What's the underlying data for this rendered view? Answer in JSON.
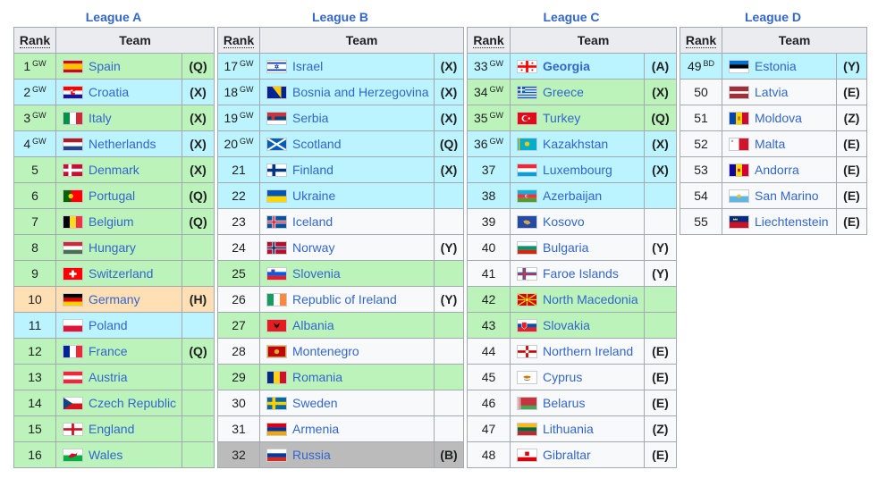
{
  "columns": {
    "rank": "Rank",
    "team": "Team"
  },
  "leagues": [
    {
      "title": "League A",
      "rows": [
        {
          "rank": "1",
          "sup": "GW",
          "team": "Spain",
          "q": "(Q)",
          "color": "green",
          "flag": "es"
        },
        {
          "rank": "2",
          "sup": "GW",
          "team": "Croatia",
          "q": "(X)",
          "color": "blue",
          "flag": "hr"
        },
        {
          "rank": "3",
          "sup": "GW",
          "team": "Italy",
          "q": "(X)",
          "color": "green",
          "flag": "it"
        },
        {
          "rank": "4",
          "sup": "GW",
          "team": "Netherlands",
          "q": "(X)",
          "color": "blue",
          "flag": "nl"
        },
        {
          "rank": "5",
          "sup": "",
          "team": "Denmark",
          "q": "(X)",
          "color": "green",
          "flag": "dk"
        },
        {
          "rank": "6",
          "sup": "",
          "team": "Portugal",
          "q": "(Q)",
          "color": "green",
          "flag": "pt"
        },
        {
          "rank": "7",
          "sup": "",
          "team": "Belgium",
          "q": "(Q)",
          "color": "green",
          "flag": "be"
        },
        {
          "rank": "8",
          "sup": "",
          "team": "Hungary",
          "q": "",
          "color": "green",
          "flag": "hu"
        },
        {
          "rank": "9",
          "sup": "",
          "team": "Switzerland",
          "q": "",
          "color": "green",
          "flag": "ch"
        },
        {
          "rank": "10",
          "sup": "",
          "team": "Germany",
          "q": "(H)",
          "color": "orange",
          "flag": "de"
        },
        {
          "rank": "11",
          "sup": "",
          "team": "Poland",
          "q": "",
          "color": "blue",
          "flag": "pl"
        },
        {
          "rank": "12",
          "sup": "",
          "team": "France",
          "q": "(Q)",
          "color": "green",
          "flag": "fr"
        },
        {
          "rank": "13",
          "sup": "",
          "team": "Austria",
          "q": "",
          "color": "green",
          "flag": "at"
        },
        {
          "rank": "14",
          "sup": "",
          "team": "Czech Republic",
          "q": "",
          "color": "green",
          "flag": "cz"
        },
        {
          "rank": "15",
          "sup": "",
          "team": "England",
          "q": "",
          "color": "green",
          "flag": "en"
        },
        {
          "rank": "16",
          "sup": "",
          "team": "Wales",
          "q": "",
          "color": "green",
          "flag": "wa"
        }
      ]
    },
    {
      "title": "League B",
      "rows": [
        {
          "rank": "17",
          "sup": "GW",
          "team": "Israel",
          "q": "(X)",
          "color": "blue",
          "flag": "il"
        },
        {
          "rank": "18",
          "sup": "GW",
          "team": "Bosnia and Herzegovina",
          "q": "(X)",
          "color": "blue",
          "flag": "ba"
        },
        {
          "rank": "19",
          "sup": "GW",
          "team": "Serbia",
          "q": "(X)",
          "color": "blue",
          "flag": "rs"
        },
        {
          "rank": "20",
          "sup": "GW",
          "team": "Scotland",
          "q": "(Q)",
          "color": "blue",
          "flag": "sc"
        },
        {
          "rank": "21",
          "sup": "",
          "team": "Finland",
          "q": "(X)",
          "color": "blue",
          "flag": "fi"
        },
        {
          "rank": "22",
          "sup": "",
          "team": "Ukraine",
          "q": "",
          "color": "blue",
          "flag": "ua"
        },
        {
          "rank": "23",
          "sup": "",
          "team": "Iceland",
          "q": "",
          "color": "white",
          "flag": "is"
        },
        {
          "rank": "24",
          "sup": "",
          "team": "Norway",
          "q": "(Y)",
          "color": "white",
          "flag": "no"
        },
        {
          "rank": "25",
          "sup": "",
          "team": "Slovenia",
          "q": "",
          "color": "green",
          "flag": "si"
        },
        {
          "rank": "26",
          "sup": "",
          "team": "Republic of Ireland",
          "q": "(Y)",
          "color": "white",
          "flag": "ie"
        },
        {
          "rank": "27",
          "sup": "",
          "team": "Albania",
          "q": "",
          "color": "green",
          "flag": "al"
        },
        {
          "rank": "28",
          "sup": "",
          "team": "Montenegro",
          "q": "",
          "color": "white",
          "flag": "me"
        },
        {
          "rank": "29",
          "sup": "",
          "team": "Romania",
          "q": "",
          "color": "green",
          "flag": "ro"
        },
        {
          "rank": "30",
          "sup": "",
          "team": "Sweden",
          "q": "",
          "color": "white",
          "flag": "se"
        },
        {
          "rank": "31",
          "sup": "",
          "team": "Armenia",
          "q": "",
          "color": "white",
          "flag": "am"
        },
        {
          "rank": "32",
          "sup": "",
          "team": "Russia",
          "q": "(B)",
          "color": "grey",
          "flag": "ru"
        }
      ]
    },
    {
      "title": "League C",
      "rows": [
        {
          "rank": "33",
          "sup": "GW",
          "team": "Georgia",
          "q": "(A)",
          "color": "blue",
          "flag": "ge",
          "bold": true
        },
        {
          "rank": "34",
          "sup": "GW",
          "team": "Greece",
          "q": "(X)",
          "color": "green",
          "flag": "gr"
        },
        {
          "rank": "35",
          "sup": "GW",
          "team": "Turkey",
          "q": "(Q)",
          "color": "green",
          "flag": "tr"
        },
        {
          "rank": "36",
          "sup": "GW",
          "team": "Kazakhstan",
          "q": "(X)",
          "color": "blue",
          "flag": "kz"
        },
        {
          "rank": "37",
          "sup": "",
          "team": "Luxembourg",
          "q": "(X)",
          "color": "blue",
          "flag": "lu"
        },
        {
          "rank": "38",
          "sup": "",
          "team": "Azerbaijan",
          "q": "",
          "color": "blue",
          "flag": "az"
        },
        {
          "rank": "39",
          "sup": "",
          "team": "Kosovo",
          "q": "",
          "color": "white",
          "flag": "xk"
        },
        {
          "rank": "40",
          "sup": "",
          "team": "Bulgaria",
          "q": "(Y)",
          "color": "white",
          "flag": "bg"
        },
        {
          "rank": "41",
          "sup": "",
          "team": "Faroe Islands",
          "q": "(Y)",
          "color": "white",
          "flag": "fo"
        },
        {
          "rank": "42",
          "sup": "",
          "team": "North Macedonia",
          "q": "",
          "color": "green",
          "flag": "mk"
        },
        {
          "rank": "43",
          "sup": "",
          "team": "Slovakia",
          "q": "",
          "color": "green",
          "flag": "sk"
        },
        {
          "rank": "44",
          "sup": "",
          "team": "Northern Ireland",
          "q": "(E)",
          "color": "white",
          "flag": "ni"
        },
        {
          "rank": "45",
          "sup": "",
          "team": "Cyprus",
          "q": "(E)",
          "color": "white",
          "flag": "cy"
        },
        {
          "rank": "46",
          "sup": "",
          "team": "Belarus",
          "q": "(E)",
          "color": "white",
          "flag": "by"
        },
        {
          "rank": "47",
          "sup": "",
          "team": "Lithuania",
          "q": "(Z)",
          "color": "white",
          "flag": "lt"
        },
        {
          "rank": "48",
          "sup": "",
          "team": "Gibraltar",
          "q": "(E)",
          "color": "white",
          "flag": "gi"
        }
      ]
    },
    {
      "title": "League D",
      "rows": [
        {
          "rank": "49",
          "sup": "BD",
          "team": "Estonia",
          "q": "(Y)",
          "color": "blue",
          "flag": "ee"
        },
        {
          "rank": "50",
          "sup": "",
          "team": "Latvia",
          "q": "(E)",
          "color": "white",
          "flag": "lv"
        },
        {
          "rank": "51",
          "sup": "",
          "team": "Moldova",
          "q": "(Z)",
          "color": "white",
          "flag": "md"
        },
        {
          "rank": "52",
          "sup": "",
          "team": "Malta",
          "q": "(E)",
          "color": "white",
          "flag": "mt"
        },
        {
          "rank": "53",
          "sup": "",
          "team": "Andorra",
          "q": "(E)",
          "color": "white",
          "flag": "ad"
        },
        {
          "rank": "54",
          "sup": "",
          "team": "San Marino",
          "q": "(E)",
          "color": "white",
          "flag": "sm"
        },
        {
          "rank": "55",
          "sup": "",
          "team": "Liechtenstein",
          "q": "(E)",
          "color": "white",
          "flag": "li"
        }
      ]
    }
  ]
}
